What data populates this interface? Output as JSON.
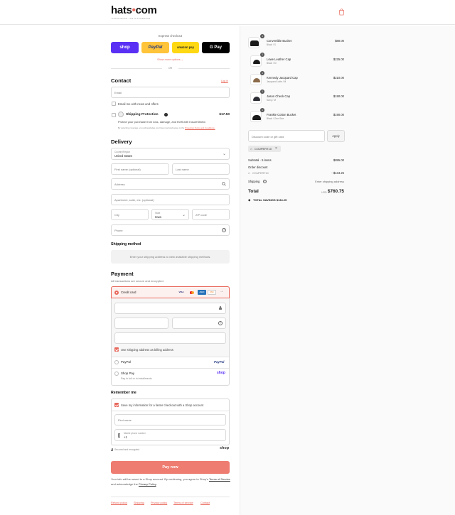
{
  "header": {
    "logo_main": "hats",
    "logo_dot": "•",
    "logo_tld": "com",
    "tagline": "EXPERIENCE THE DIFFERENCE",
    "cart_icon": "shopping-bag-icon"
  },
  "express": {
    "title": "Express checkout",
    "shop": "shop",
    "paypal": "PayPal",
    "amazon": "amazon pay",
    "gpay": "G Pay",
    "more": "Show more options",
    "or": "OR"
  },
  "contact": {
    "heading": "Contact",
    "login": "Log in",
    "email_placeholder": "Email",
    "news_label": "Email me with news and offers"
  },
  "protection": {
    "title": "Shipping Protection",
    "price": "$17.50",
    "desc": "Protect your purchase from loss, damage, and theft with InsureShield.",
    "fine": "By selecting coverage, you acknowledge you have read and agree to the",
    "fine_link": "Protection Terms and Conditions."
  },
  "delivery": {
    "heading": "Delivery",
    "country_label": "Country/Region",
    "country_value": "United States",
    "first_name": "First name (optional)",
    "last_name": "Last name",
    "address": "Address",
    "apartment": "Apartment, suite, etc. (optional)",
    "city": "City",
    "state_label": "State",
    "state_value": "Iowa",
    "zip": "ZIP code",
    "phone": "Phone"
  },
  "shipping_method": {
    "heading": "Shipping method",
    "message": "Enter your shipping address to view available shipping methods."
  },
  "payment": {
    "heading": "Payment",
    "subtitle": "All transactions are secure and encrypted.",
    "credit_card": "Credit card",
    "cards": [
      "VISA",
      "MC",
      "AMEX",
      "DISC"
    ],
    "billing_same": "Use shipping address as billing address",
    "paypal": "PayPal",
    "paypal_logo": "PayPal",
    "shoppay": "Shop Pay",
    "shoppay_sub": "Pay in full or in installments",
    "shoppay_logo": "shop"
  },
  "remember": {
    "heading": "Remember me",
    "save_label": "Save my information for a faster checkout with a Shop account",
    "first_name": "First name",
    "mobile_label": "Mobile phone number",
    "mobile_value": "+1",
    "secure": "Secured and encrypted",
    "shop_logo": "shop"
  },
  "pay": {
    "button": "Pay now",
    "terms_1": "Your info will be saved to a Shop account. By continuing, you agree to Shop's",
    "terms_link_1": "Terms of Service",
    "terms_2": "and acknowledge the",
    "terms_link_2": "Privacy Policy",
    "terms_3": "."
  },
  "footer": [
    "Refund policy",
    "Shipping",
    "Privacy policy",
    "Terms of service",
    "Contact"
  ],
  "cart": {
    "items": [
      {
        "name": "Convertible Bucket",
        "variant": "Black / S",
        "qty": "1",
        "price": "$80.00"
      },
      {
        "name": "Lowe Leather Cap",
        "variant": "Black / M",
        "qty": "1",
        "price": "$225.00"
      },
      {
        "name": "Kennedy Jacquard Cap",
        "variant": "Jacquard Latte / M",
        "qty": "1",
        "price": "$210.00"
      },
      {
        "name": "Jason Check Cap",
        "variant": "Navy / M",
        "qty": "1",
        "price": "$190.00"
      },
      {
        "name": "Frankie Cotton Bucket",
        "variant": "Black / One Size",
        "qty": "1",
        "price": "$190.00"
      }
    ],
    "discount_placeholder": "Discount code or gift card",
    "apply": "Apply",
    "code": "COUPERT10",
    "subtotal_label": "Subtotal · 5 items",
    "subtotal": "$895.00",
    "order_discount": "Order discount",
    "discount_code": "COUPERT10",
    "discount_value": "- $134.25",
    "shipping_label": "Shipping",
    "shipping_value": "Enter shipping address",
    "total_label": "Total",
    "currency": "USD",
    "total": "$760.75",
    "savings": "TOTAL SAVINGS  $134.25"
  }
}
